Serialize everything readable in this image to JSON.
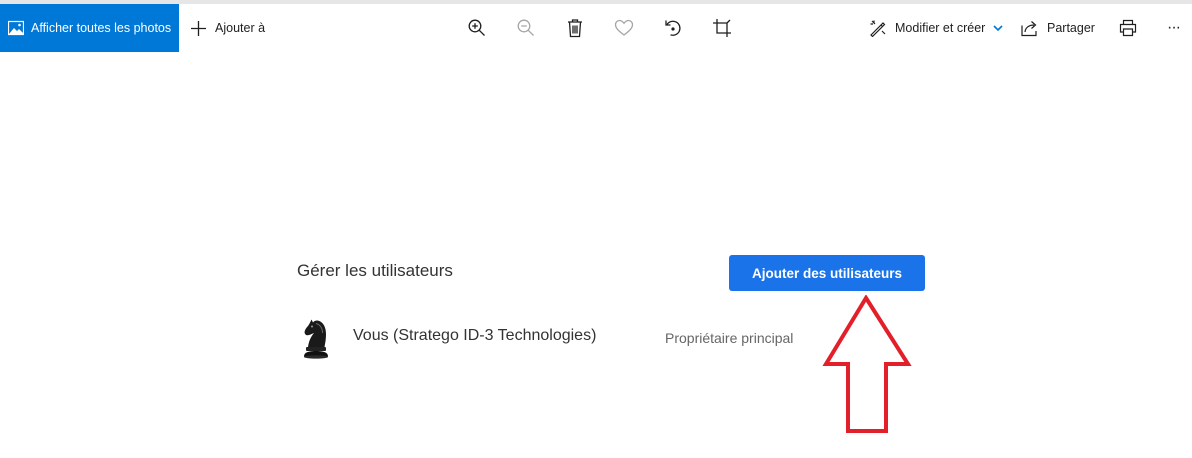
{
  "toolbar": {
    "show_all_photos": "Afficher toutes les photos",
    "add_to": "Ajouter à",
    "edit_create": "Modifier et créer",
    "share": "Partager",
    "more": "···"
  },
  "panel": {
    "title": "Gérer les utilisateurs",
    "add_users_button": "Ajouter des utilisateurs",
    "user": {
      "name": "Vous (Stratego ID-3 Technologies)",
      "role": "Propriétaire principal"
    }
  },
  "colors": {
    "accent": "#0078d7",
    "button": "#1a73e8",
    "annotation_arrow": "#e3202a"
  },
  "icons": [
    "photo-icon",
    "plus-icon",
    "zoom-in-icon",
    "zoom-out-icon",
    "trash-icon",
    "heart-icon",
    "rotate-icon",
    "crop-icon",
    "edit-create-icon",
    "chevron-down-icon",
    "share-icon",
    "print-icon",
    "more-icon",
    "avatar-chess-knight"
  ]
}
